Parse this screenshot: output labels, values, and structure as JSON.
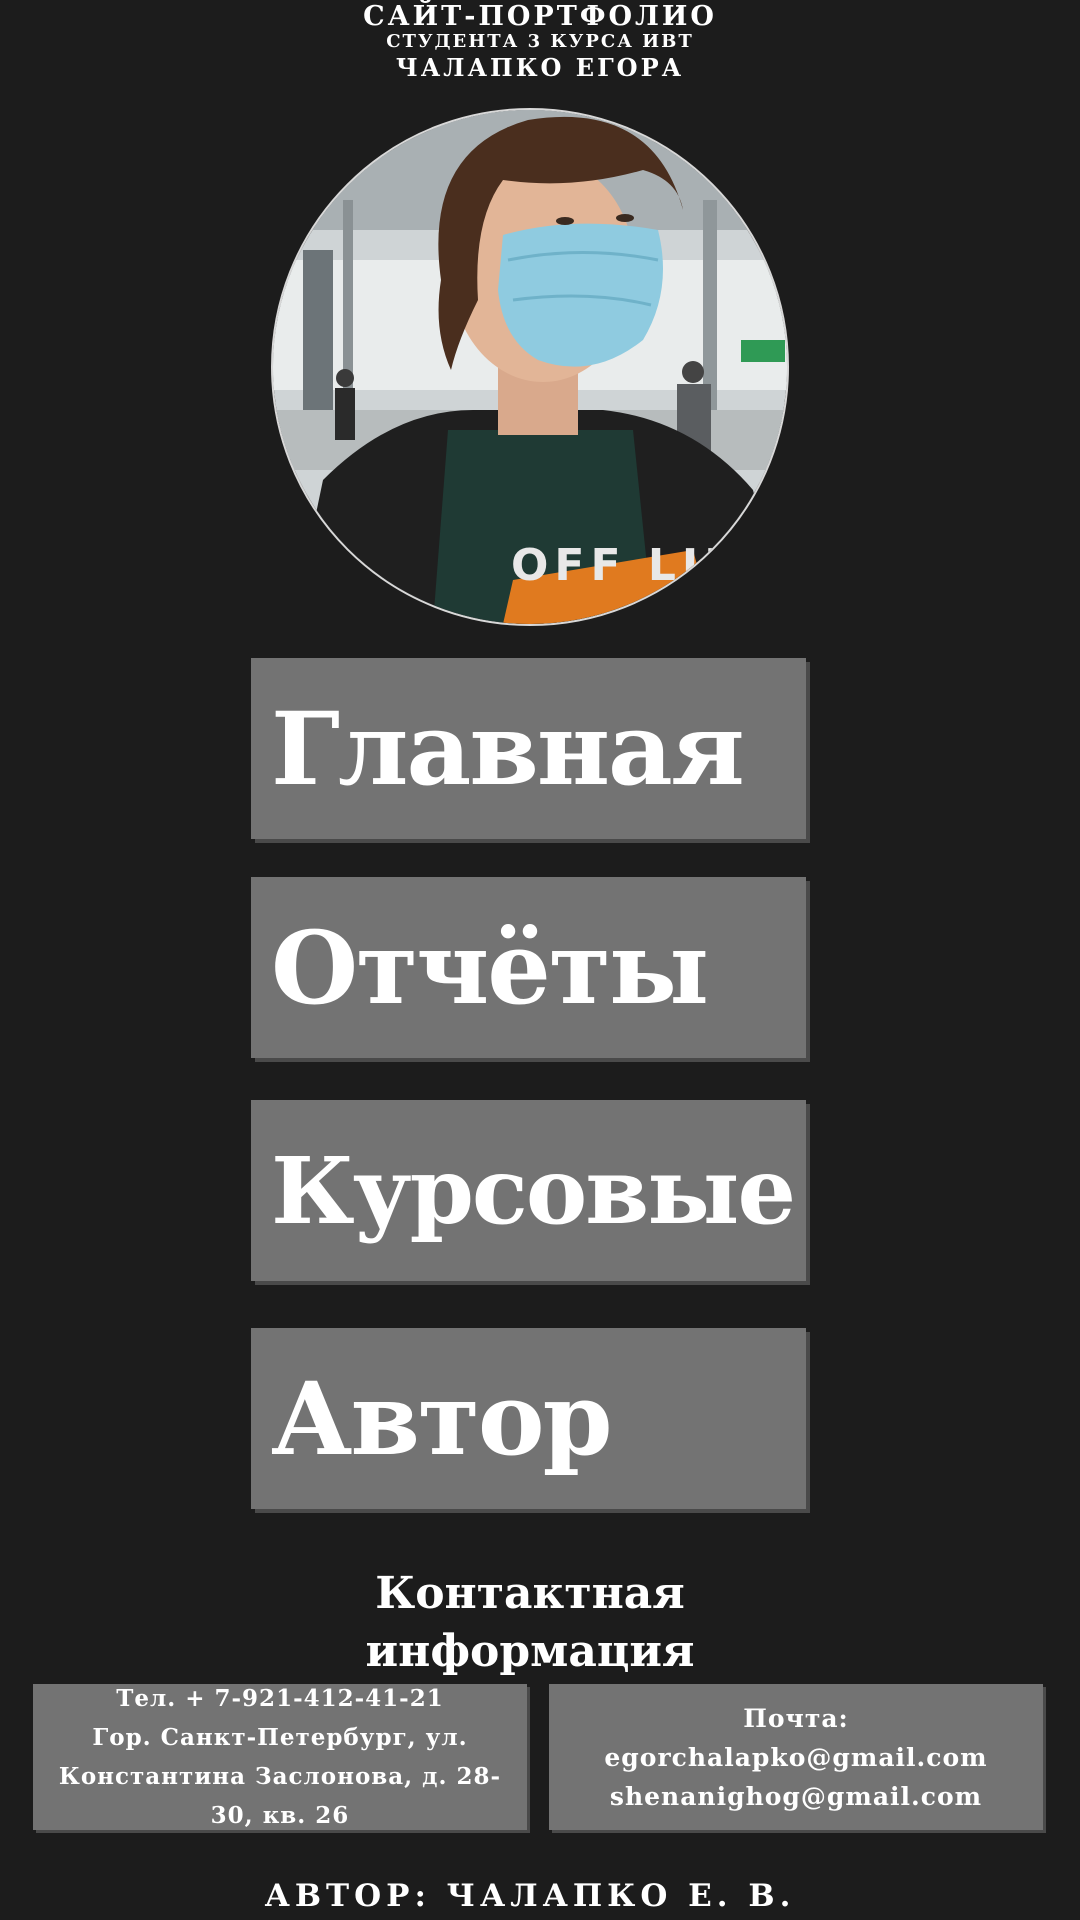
{
  "header": {
    "line1": "САЙТ-ПОРТФОЛИО",
    "line2": "СТУДЕНТА 3 КУРСА ИВТ",
    "line3": "ЧАЛАПКО ЕГОРА"
  },
  "avatar": {
    "shirt_text": "OFF LIN"
  },
  "nav": {
    "items": [
      {
        "label": "Главная"
      },
      {
        "label": "Отчёты"
      },
      {
        "label": "Курсовые"
      },
      {
        "label": "Автор"
      }
    ]
  },
  "contact": {
    "title_line1": "Контактная",
    "title_line2": "информация",
    "phone": "Тел. + 7-921-412-41-21",
    "address_line1": "Гор. Санкт-Петербург, ул.",
    "address_line2": "Константина Заслонова, д. 28-",
    "address_line3": "30, кв. 26",
    "mail_label": "Почта:",
    "email1": "egorchalapko@gmail.com",
    "email2": "shenanighog@gmail.com"
  },
  "footer": {
    "author": "АВТОР: ЧАЛАПКО Е. В."
  },
  "colors": {
    "background": "#1c1c1c",
    "button": "#737373",
    "text": "#ffffff"
  }
}
